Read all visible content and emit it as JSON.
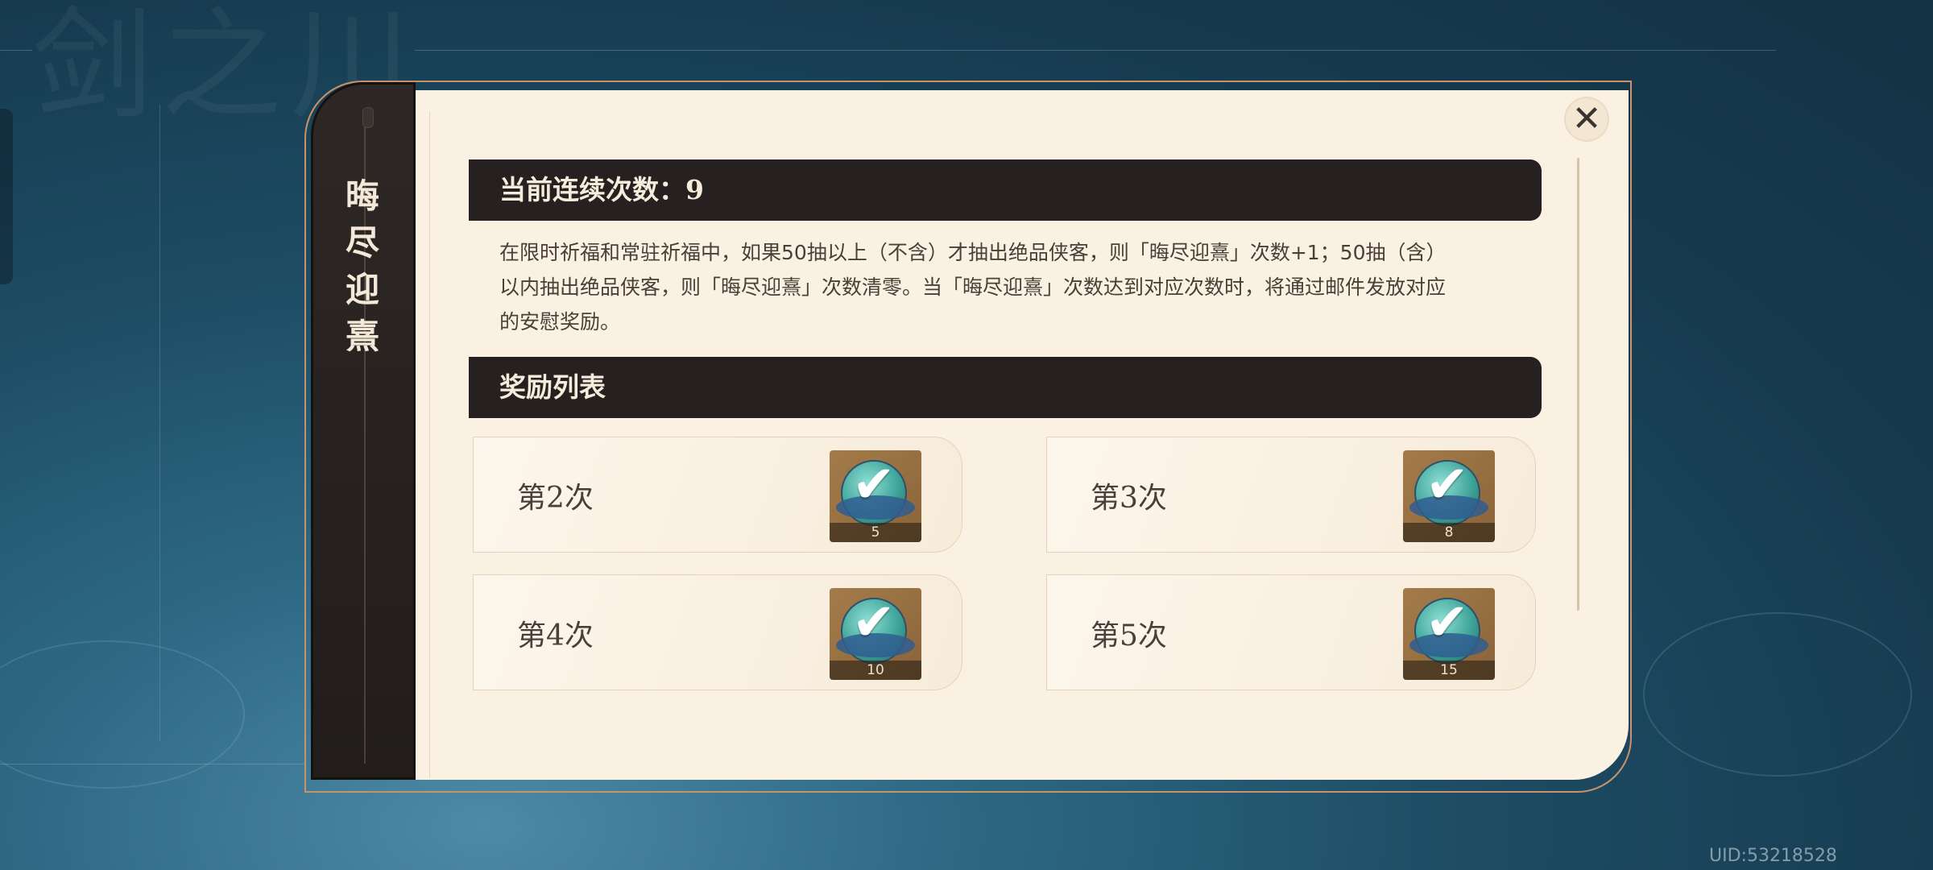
{
  "dialog": {
    "title_chars": [
      "晦",
      "尽",
      "迎",
      "熹"
    ],
    "close_icon": "close-x-icon"
  },
  "current_count": {
    "label": "当前连续次数：9"
  },
  "description": {
    "lines": [
      "在限时祈福和常驻祈福中，如果50抽以上（不含）才抽出绝品侠客，则「晦尽迎熹」次数+1；50抽（含）",
      "以内抽出绝品侠客，则「晦尽迎熹」次数清零。当「晦尽迎熹」次数达到对应次数时，将通过邮件发放对应",
      "的安慰奖励。"
    ]
  },
  "rewards": {
    "heading": "奖励列表",
    "items": [
      {
        "label": "第2次",
        "count": "5",
        "icon": "reward-orb-icon"
      },
      {
        "label": "第3次",
        "count": "8",
        "icon": "reward-orb-icon"
      },
      {
        "label": "第4次",
        "count": "10",
        "icon": "reward-orb-icon"
      },
      {
        "label": "第5次",
        "count": "15",
        "icon": "reward-orb-icon"
      }
    ]
  },
  "footer": {
    "uid": "UID:53218528"
  }
}
